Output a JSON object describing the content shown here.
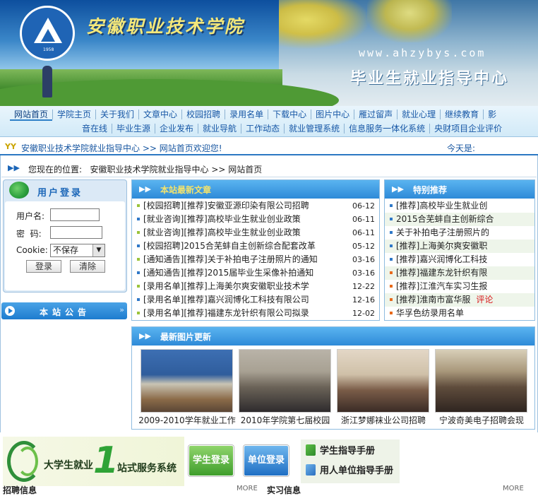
{
  "banner": {
    "school_name": "安徽职业技术学院",
    "url": "www.ahzybys.com",
    "center_name": "毕业生就业指导中心",
    "logo_year": "1958"
  },
  "nav": {
    "row1": [
      "网站首页",
      "学院主页",
      "关于我们",
      "文章中心",
      "校园招聘",
      "录用名单",
      "下载中心",
      "图片中心",
      "雁过留声",
      "就业心理",
      "继续教育",
      "影"
    ],
    "row2": [
      "音在线",
      "毕业生源",
      "企业发布",
      "就业导航",
      "工作动态",
      "就业管理系统",
      "信息服务一体化系统",
      "央财项目企业评价"
    ]
  },
  "welcome": {
    "text": "安徽职业技术学院就业指导中心 >> 网站首页欢迎您!",
    "today_label": "今天是:"
  },
  "location": {
    "label": "您现在的位置:",
    "path": "安徽职业技术学院就业指导中心 >> 网站首页"
  },
  "login": {
    "title": "用户登录",
    "username_label": "用户名:",
    "password_label": "密  码:",
    "cookie_label": "Cookie:",
    "cookie_value": "不保存",
    "login_button": "登录",
    "clear_button": "清除"
  },
  "notice": {
    "title": "本站公告"
  },
  "news": {
    "title": "本站最新文章",
    "items": [
      {
        "text": "[校园招聘][推荐]安徽亚源印染有限公司招聘",
        "date": "06-12",
        "bullet": "#9ac33b"
      },
      {
        "text": "[就业咨询][推荐]高校毕业生就业创业政策",
        "date": "06-11",
        "bullet": "#2f78c8"
      },
      {
        "text": "[就业咨询][推荐]高校毕业生就业创业政策",
        "date": "06-11",
        "bullet": "#9ac33b"
      },
      {
        "text": "[校园招聘]2015合芜蚌自主创新综合配套改革",
        "date": "05-12",
        "bullet": "#2f78c8"
      },
      {
        "text": "[通知通告][推荐]关于补拍电子注册照片的通知",
        "date": "03-16",
        "bullet": "#9ac33b"
      },
      {
        "text": "[通知通告][推荐]2015届毕业生采像补拍通知",
        "date": "03-16",
        "bullet": "#2f78c8"
      },
      {
        "text": "[录用名单][推荐]上海美尔爽安徽职业技术学",
        "date": "12-22",
        "bullet": "#9ac33b"
      },
      {
        "text": "[录用名单][推荐]嘉兴润博化工科技有限公司",
        "date": "12-16",
        "bullet": "#2f78c8"
      },
      {
        "text": "[录用名单][推荐]福建东龙针织有限公司拟录",
        "date": "12-02",
        "bullet": "#9ac33b"
      }
    ]
  },
  "recommend": {
    "title": "特别推荐",
    "items": [
      {
        "text": "[推荐]高校毕业生就业创",
        "comment": ""
      },
      {
        "text": "2015合芜蚌自主创新综合",
        "comment": ""
      },
      {
        "text": "关于补拍电子注册照片的",
        "comment": ""
      },
      {
        "text": "[推荐]上海美尔爽安徽职",
        "comment": ""
      },
      {
        "text": "[推荐]嘉兴润博化工科技",
        "comment": ""
      },
      {
        "text": "[推荐]福建东龙针织有限",
        "comment": ""
      },
      {
        "text": "[推荐]江淮汽车实习生报",
        "comment": ""
      },
      {
        "text": "[推荐]淮南市富华服",
        "comment": "评论"
      },
      {
        "text": "华孚色纺录用名单",
        "comment": ""
      }
    ]
  },
  "pictures": {
    "title": "最新图片更新",
    "items": [
      {
        "caption": "2009-2010学年就业工作"
      },
      {
        "caption": "2010年学院第七届校园"
      },
      {
        "caption": "浙江梦娜袜业公司招聘"
      },
      {
        "caption": "宁波奇美电子招聘会现"
      }
    ]
  },
  "bottom": {
    "one_stop_a": "大学生就业",
    "one_stop_num": "1",
    "one_stop_b": "站式服务系统",
    "student_login": "学生登录",
    "company_login": "单位登录",
    "student_guide": "学生指导手册",
    "employer_guide": "用人单位指导手册",
    "recruit_heading": "招聘信息",
    "recruit_more": "MORE",
    "intern_heading": "实习信息",
    "intern_more": "MORE"
  }
}
